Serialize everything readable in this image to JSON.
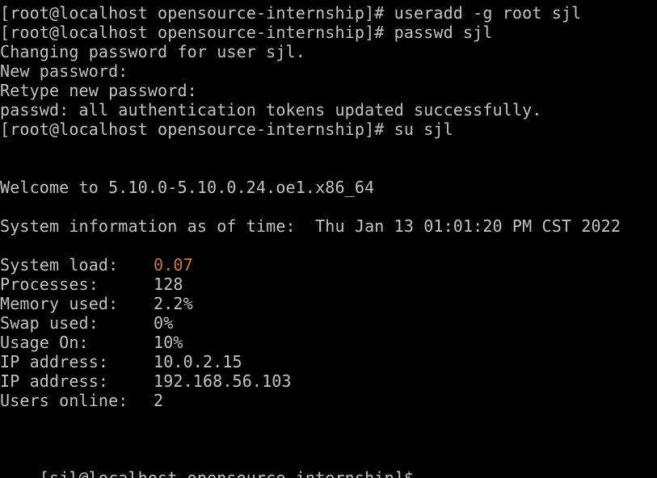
{
  "terminal": {
    "history": [
      "[root@localhost opensource-internship]# useradd -g root sjl",
      "[root@localhost opensource-internship]# passwd sjl",
      "Changing password for user sjl.",
      "New password:",
      "Retype new password:",
      "passwd: all authentication tokens updated successfully.",
      "[root@localhost opensource-internship]# su sjl"
    ],
    "welcome": "Welcome to 5.10.0-5.10.0.24.oe1.x86_64",
    "sysinfo": "System information as of time:  Thu Jan 13 01:01:20 PM CST 2022",
    "stats": [
      {
        "label": "System load:",
        "value": "0.07"
      },
      {
        "label": "Processes:",
        "value": "128"
      },
      {
        "label": "Memory used:",
        "value": "2.2%"
      },
      {
        "label": "Swap used:",
        "value": "0%"
      },
      {
        "label": "Usage On:",
        "value": "10%"
      },
      {
        "label": "IP address:",
        "value": "10.0.2.15"
      },
      {
        "label": "IP address:",
        "value": "192.168.56.103"
      },
      {
        "label": "Users online:",
        "value": "2"
      }
    ],
    "prompt": "[sjl@localhost opensource-internship]$ ",
    "colors": {
      "background": "#000000",
      "foreground": "#c2c2c2",
      "highlight": "#c87a2e"
    }
  }
}
